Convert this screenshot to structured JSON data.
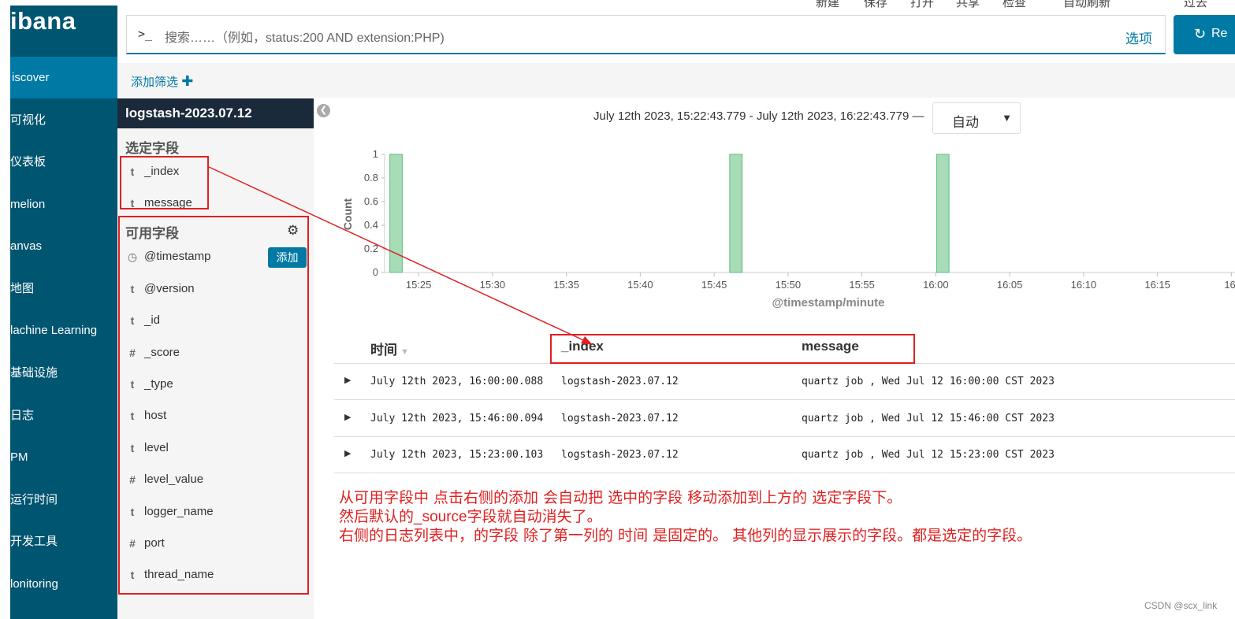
{
  "nav": {
    "logo": "ibana",
    "items": [
      {
        "label": "iscover",
        "active": true
      },
      {
        "label": "可视化"
      },
      {
        "label": "仪表板"
      },
      {
        "label": "melion"
      },
      {
        "label": "anvas"
      },
      {
        "label": "地图"
      },
      {
        "label": "lachine Learning"
      },
      {
        "label": "基础设施"
      },
      {
        "label": "日志"
      },
      {
        "label": "PM"
      },
      {
        "label": "运行时间"
      },
      {
        "label": "开发工具"
      },
      {
        "label": "lonitoring"
      }
    ]
  },
  "top_menu": [
    "新建",
    "保存",
    "打开",
    "共享",
    "检查",
    "自动刷新",
    "过去"
  ],
  "query": {
    "prompt": ">_",
    "placeholder": "搜索……（例如，status:200 AND extension:PHP)",
    "options_label": "选项",
    "refresh_label": "Re",
    "refresh_icon": "refresh-icon"
  },
  "filter": {
    "add_label": "添加筛选",
    "plus": "✚"
  },
  "sidebar": {
    "index_pattern": "logstash-2023.07.12",
    "selected_header": "选定字段",
    "selected_fields": [
      {
        "type": "t",
        "name": "_index"
      },
      {
        "type": "t",
        "name": "message"
      }
    ],
    "available_header": "可用字段",
    "add_button": "添加",
    "available_fields": [
      {
        "type": "◷",
        "name": "@timestamp"
      },
      {
        "type": "t",
        "name": "@version"
      },
      {
        "type": "t",
        "name": "_id"
      },
      {
        "type": "#",
        "name": "_score"
      },
      {
        "type": "t",
        "name": "_type"
      },
      {
        "type": "t",
        "name": "host"
      },
      {
        "type": "t",
        "name": "level"
      },
      {
        "type": "#",
        "name": "level_value"
      },
      {
        "type": "t",
        "name": "logger_name"
      },
      {
        "type": "#",
        "name": "port"
      },
      {
        "type": "t",
        "name": "thread_name"
      }
    ]
  },
  "time": {
    "range": "July 12th 2023, 15:22:43.779 - July 12th 2023, 16:22:43.779 —",
    "interval": "自动"
  },
  "chart_data": {
    "type": "bar",
    "ylabel": "Count",
    "xlabel": "@timestamp/minute",
    "ylim": [
      0,
      1
    ],
    "yticks": [
      "0",
      "0.2",
      "0.4",
      "0.6",
      "0.8",
      "1"
    ],
    "xticks": [
      "15:25",
      "15:30",
      "15:35",
      "15:40",
      "15:45",
      "15:50",
      "15:55",
      "16:00",
      "16:05",
      "16:10",
      "16:15",
      "16:"
    ],
    "x": [
      "15:23",
      "15:46",
      "16:00"
    ],
    "values": [
      1,
      1,
      1
    ],
    "bar_color": "#a8dbb8",
    "bar_stroke": "#57c17b"
  },
  "table": {
    "headers": [
      "时间",
      "_index",
      "message"
    ],
    "rows": [
      [
        "July 12th 2023, 16:00:00.088",
        "logstash-2023.07.12",
        "quartz job , Wed Jul 12 16:00:00 CST 2023"
      ],
      [
        "July 12th 2023, 15:46:00.094",
        "logstash-2023.07.12",
        "quartz job , Wed Jul 12 15:46:00 CST 2023"
      ],
      [
        "July 12th 2023, 15:23:00.103",
        "logstash-2023.07.12",
        "quartz job , Wed Jul 12 15:23:00 CST 2023"
      ]
    ]
  },
  "annotation": {
    "line1": "从可用字段中  点击右侧的添加 会自动把 选中的字段 移动添加到上方的 选定字段下。",
    "line2_pre": "然后默认的",
    "line2_src": "_source",
    "line2_post": "字段就自动消失了。",
    "line3": "右侧的日志列表中，的字段 除了第一列的 时间 是固定的。 其他列的显示展示的字段。都是选定的字段。"
  },
  "watermark": "CSDN @scx_link"
}
